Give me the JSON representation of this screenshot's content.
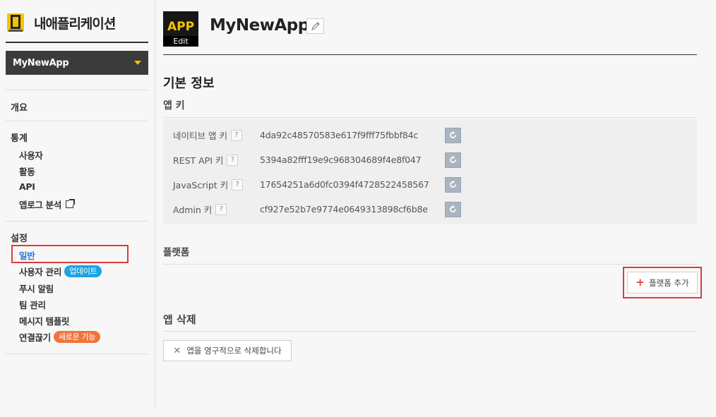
{
  "sidebar": {
    "brand_title": "내애플리케이션",
    "app_select": {
      "value": "MyNewApp"
    },
    "overview": "개요",
    "stats": {
      "heading": "통계",
      "items": [
        "사용자",
        "활동",
        "API",
        "앱로그 분석"
      ]
    },
    "settings": {
      "heading": "설정",
      "items": [
        {
          "label": "일반"
        },
        {
          "label": "사용자 관리",
          "badge": "업데이트"
        },
        {
          "label": "푸시 알림"
        },
        {
          "label": "팀 관리"
        },
        {
          "label": "메시지 템플릿"
        },
        {
          "label": "연결끊기",
          "badge": "새로운 기능"
        }
      ]
    }
  },
  "header": {
    "app_icon_text": "APP",
    "app_icon_edit": "Edit",
    "app_name": "MyNewApp"
  },
  "basic_info": {
    "title": "기본 정보",
    "app_keys_title": "앱 키",
    "keys": [
      {
        "label": "네이티브 앱 키",
        "help": "?",
        "value": "4da92c48570583e617f9fff75fbbf84c"
      },
      {
        "label": "REST API 키",
        "help": "?",
        "value": "5394a82fff19e9c968304689f4e8f047"
      },
      {
        "label": "JavaScript 키",
        "help": "?",
        "value": "17654251a6d0fc0394f4728522458567"
      },
      {
        "label": "Admin 키",
        "help": "?",
        "value": "cf927e52b7e9774e0649313898cf6b8e"
      }
    ]
  },
  "platform": {
    "title": "플랫폼",
    "add_button": "플랫폼 추가"
  },
  "delete_app": {
    "title": "앱 삭제",
    "button": "앱을 영구적으로 삭제합니다"
  },
  "colors": {
    "accent_yellow": "#f5c400",
    "active_blue": "#1f73d6",
    "highlight_red": "#e03b3b"
  }
}
